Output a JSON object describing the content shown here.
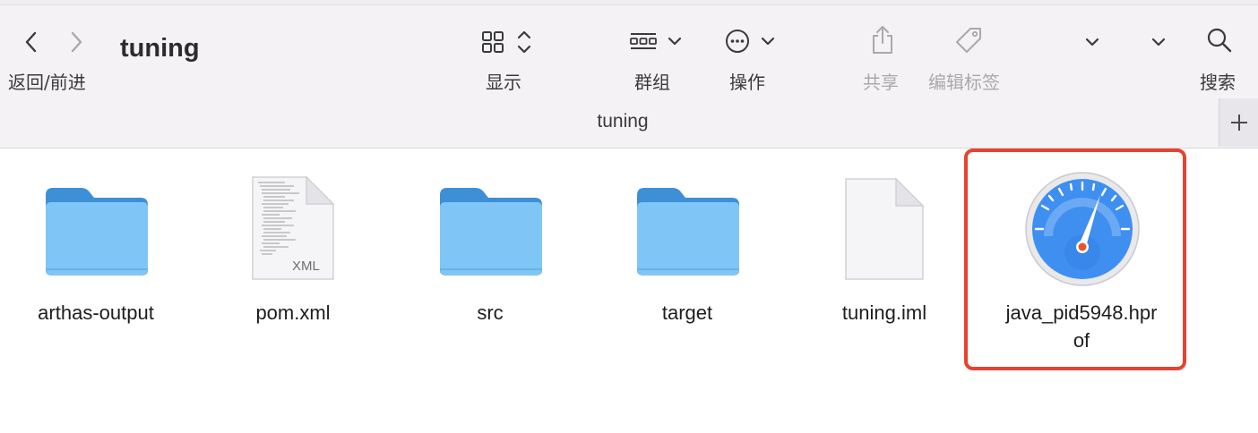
{
  "window": {
    "title": "tuning",
    "path_title": "tuning"
  },
  "toolbar": {
    "back_forward_label": "返回/前进",
    "view_label": "显示",
    "group_label": "群组",
    "action_label": "操作",
    "share_label": "共享",
    "tags_label": "编辑标签",
    "search_label": "搜索"
  },
  "files": [
    {
      "name": "arthas-output",
      "kind": "folder-icon"
    },
    {
      "name": "pom.xml",
      "kind": "xml-document-icon",
      "badge": "XML"
    },
    {
      "name": "src",
      "kind": "folder-icon"
    },
    {
      "name": "target",
      "kind": "folder-icon"
    },
    {
      "name": "tuning.iml",
      "kind": "blank-document-icon"
    },
    {
      "name_line1": "java_pid5948.hpr",
      "name_line2": "of",
      "kind": "gauge-app-icon",
      "selected": true
    }
  ],
  "colors": {
    "folder_blue": "#5fb4ee",
    "highlight_red": "#e5432f",
    "gauge_blue": "#3f8ff0",
    "needle_orange": "#e8562d"
  }
}
